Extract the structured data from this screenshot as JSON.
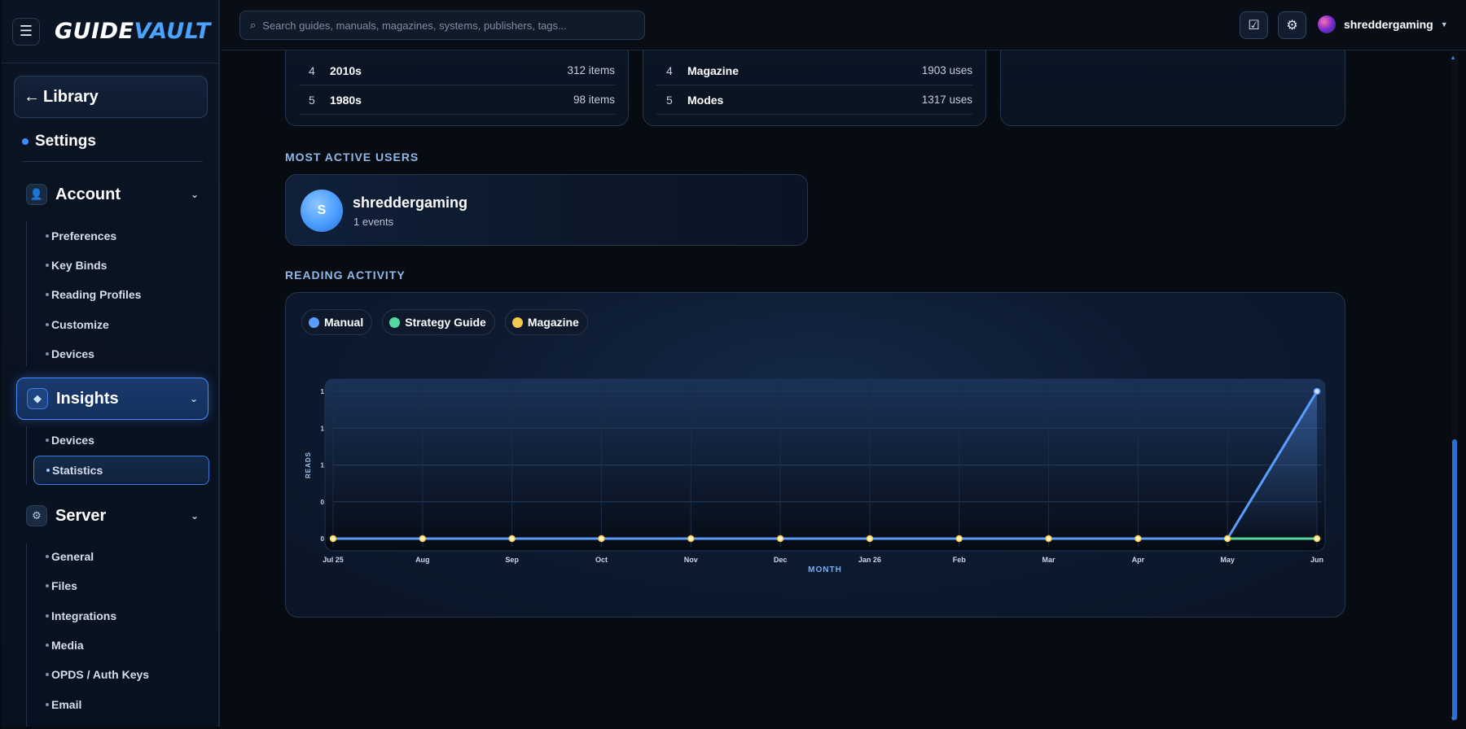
{
  "app": {
    "logo_a": "GUIDE",
    "logo_b": "VAULT"
  },
  "topbar": {
    "search_placeholder": "Search guides, manuals, magazines, systems, publishers, tags...",
    "username": "shreddergaming"
  },
  "sidebar": {
    "library": "Library",
    "settings": "Settings",
    "account": {
      "label": "Account",
      "items": [
        "Preferences",
        "Key Binds",
        "Reading Profiles",
        "Customize",
        "Devices"
      ]
    },
    "insights": {
      "label": "Insights",
      "items": [
        "Devices",
        "Statistics"
      ]
    },
    "server": {
      "label": "Server",
      "items": [
        "General",
        "Files",
        "Integrations",
        "Media",
        "OPDS / Auth Keys",
        "Email"
      ]
    }
  },
  "decades": [
    {
      "rank": "4",
      "name": "2010s",
      "count": "312 items"
    },
    {
      "rank": "5",
      "name": "1980s",
      "count": "98 items"
    }
  ],
  "tags": [
    {
      "rank": "4",
      "name": "Magazine",
      "count": "1903 uses"
    },
    {
      "rank": "5",
      "name": "Modes",
      "count": "1317 uses"
    }
  ],
  "active_users": {
    "title": "MOST ACTIVE USERS",
    "users": [
      {
        "initial": "S",
        "name": "shreddergaming",
        "events": "1 events"
      }
    ]
  },
  "reading_activity": {
    "title": "READING ACTIVITY"
  },
  "colors": {
    "accent": "#3d8cff",
    "manual": "#5b9dff",
    "strategy_guide": "#56d6a0",
    "magazine": "#f5c84c"
  },
  "chart_data": {
    "type": "line",
    "xlabel": "MONTH",
    "ylabel": "READS",
    "categories": [
      "Jul 25",
      "Aug",
      "Sep",
      "Oct",
      "Nov",
      "Dec",
      "Jan 26",
      "Feb",
      "Mar",
      "Apr",
      "May",
      "Jun"
    ],
    "y_tick_labels": [
      "0",
      "0",
      "1",
      "1",
      "1"
    ],
    "ylim": [
      0,
      1
    ],
    "grid": true,
    "legend_position": "top-left",
    "series": [
      {
        "name": "Manual",
        "color": "#5b9dff",
        "values": [
          0,
          0,
          0,
          0,
          0,
          0,
          0,
          0,
          0,
          0,
          0,
          1
        ]
      },
      {
        "name": "Strategy Guide",
        "color": "#56d6a0",
        "values": [
          0,
          0,
          0,
          0,
          0,
          0,
          0,
          0,
          0,
          0,
          0,
          0
        ]
      },
      {
        "name": "Magazine",
        "color": "#f5c84c",
        "values": [
          0,
          0,
          0,
          0,
          0,
          0,
          0,
          0,
          0,
          0,
          0,
          0
        ]
      }
    ]
  }
}
